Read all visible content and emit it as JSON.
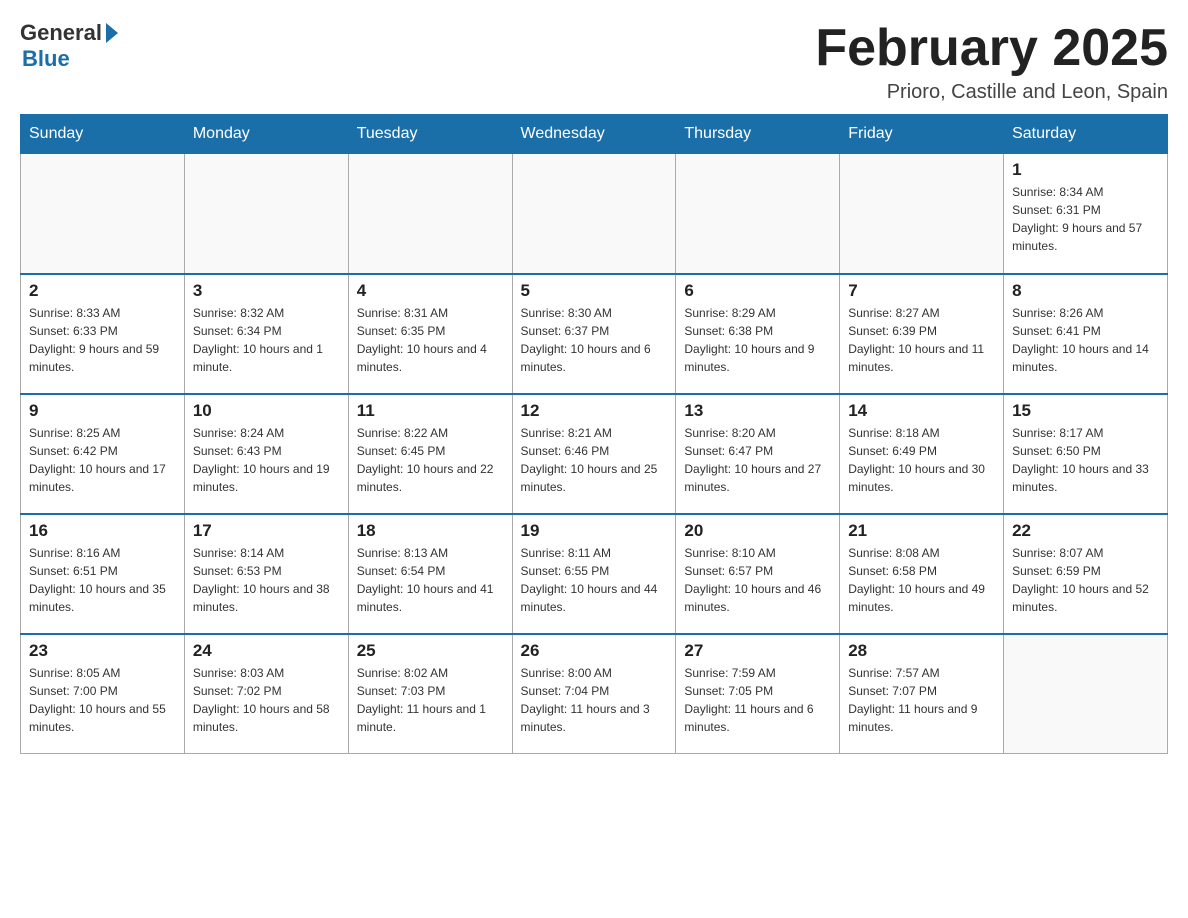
{
  "header": {
    "logo_general": "General",
    "logo_blue": "Blue",
    "month_title": "February 2025",
    "location": "Prioro, Castille and Leon, Spain"
  },
  "weekdays": [
    "Sunday",
    "Monday",
    "Tuesday",
    "Wednesday",
    "Thursday",
    "Friday",
    "Saturday"
  ],
  "weeks": [
    [
      {
        "day": "",
        "info": ""
      },
      {
        "day": "",
        "info": ""
      },
      {
        "day": "",
        "info": ""
      },
      {
        "day": "",
        "info": ""
      },
      {
        "day": "",
        "info": ""
      },
      {
        "day": "",
        "info": ""
      },
      {
        "day": "1",
        "info": "Sunrise: 8:34 AM\nSunset: 6:31 PM\nDaylight: 9 hours and 57 minutes."
      }
    ],
    [
      {
        "day": "2",
        "info": "Sunrise: 8:33 AM\nSunset: 6:33 PM\nDaylight: 9 hours and 59 minutes."
      },
      {
        "day": "3",
        "info": "Sunrise: 8:32 AM\nSunset: 6:34 PM\nDaylight: 10 hours and 1 minute."
      },
      {
        "day": "4",
        "info": "Sunrise: 8:31 AM\nSunset: 6:35 PM\nDaylight: 10 hours and 4 minutes."
      },
      {
        "day": "5",
        "info": "Sunrise: 8:30 AM\nSunset: 6:37 PM\nDaylight: 10 hours and 6 minutes."
      },
      {
        "day": "6",
        "info": "Sunrise: 8:29 AM\nSunset: 6:38 PM\nDaylight: 10 hours and 9 minutes."
      },
      {
        "day": "7",
        "info": "Sunrise: 8:27 AM\nSunset: 6:39 PM\nDaylight: 10 hours and 11 minutes."
      },
      {
        "day": "8",
        "info": "Sunrise: 8:26 AM\nSunset: 6:41 PM\nDaylight: 10 hours and 14 minutes."
      }
    ],
    [
      {
        "day": "9",
        "info": "Sunrise: 8:25 AM\nSunset: 6:42 PM\nDaylight: 10 hours and 17 minutes."
      },
      {
        "day": "10",
        "info": "Sunrise: 8:24 AM\nSunset: 6:43 PM\nDaylight: 10 hours and 19 minutes."
      },
      {
        "day": "11",
        "info": "Sunrise: 8:22 AM\nSunset: 6:45 PM\nDaylight: 10 hours and 22 minutes."
      },
      {
        "day": "12",
        "info": "Sunrise: 8:21 AM\nSunset: 6:46 PM\nDaylight: 10 hours and 25 minutes."
      },
      {
        "day": "13",
        "info": "Sunrise: 8:20 AM\nSunset: 6:47 PM\nDaylight: 10 hours and 27 minutes."
      },
      {
        "day": "14",
        "info": "Sunrise: 8:18 AM\nSunset: 6:49 PM\nDaylight: 10 hours and 30 minutes."
      },
      {
        "day": "15",
        "info": "Sunrise: 8:17 AM\nSunset: 6:50 PM\nDaylight: 10 hours and 33 minutes."
      }
    ],
    [
      {
        "day": "16",
        "info": "Sunrise: 8:16 AM\nSunset: 6:51 PM\nDaylight: 10 hours and 35 minutes."
      },
      {
        "day": "17",
        "info": "Sunrise: 8:14 AM\nSunset: 6:53 PM\nDaylight: 10 hours and 38 minutes."
      },
      {
        "day": "18",
        "info": "Sunrise: 8:13 AM\nSunset: 6:54 PM\nDaylight: 10 hours and 41 minutes."
      },
      {
        "day": "19",
        "info": "Sunrise: 8:11 AM\nSunset: 6:55 PM\nDaylight: 10 hours and 44 minutes."
      },
      {
        "day": "20",
        "info": "Sunrise: 8:10 AM\nSunset: 6:57 PM\nDaylight: 10 hours and 46 minutes."
      },
      {
        "day": "21",
        "info": "Sunrise: 8:08 AM\nSunset: 6:58 PM\nDaylight: 10 hours and 49 minutes."
      },
      {
        "day": "22",
        "info": "Sunrise: 8:07 AM\nSunset: 6:59 PM\nDaylight: 10 hours and 52 minutes."
      }
    ],
    [
      {
        "day": "23",
        "info": "Sunrise: 8:05 AM\nSunset: 7:00 PM\nDaylight: 10 hours and 55 minutes."
      },
      {
        "day": "24",
        "info": "Sunrise: 8:03 AM\nSunset: 7:02 PM\nDaylight: 10 hours and 58 minutes."
      },
      {
        "day": "25",
        "info": "Sunrise: 8:02 AM\nSunset: 7:03 PM\nDaylight: 11 hours and 1 minute."
      },
      {
        "day": "26",
        "info": "Sunrise: 8:00 AM\nSunset: 7:04 PM\nDaylight: 11 hours and 3 minutes."
      },
      {
        "day": "27",
        "info": "Sunrise: 7:59 AM\nSunset: 7:05 PM\nDaylight: 11 hours and 6 minutes."
      },
      {
        "day": "28",
        "info": "Sunrise: 7:57 AM\nSunset: 7:07 PM\nDaylight: 11 hours and 9 minutes."
      },
      {
        "day": "",
        "info": ""
      }
    ]
  ]
}
